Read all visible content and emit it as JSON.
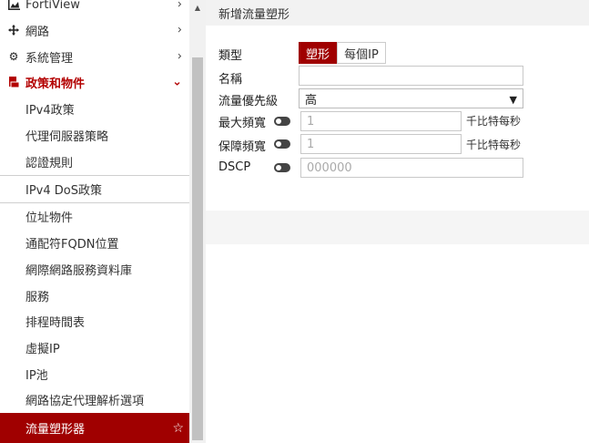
{
  "sidebar": {
    "top_items": [
      {
        "label": "FortiView",
        "icon": "chart-icon"
      },
      {
        "label": "網路",
        "icon": "move-icon"
      },
      {
        "label": "系統管理",
        "icon": "gear-icon"
      },
      {
        "label": "政策和物件",
        "icon": "policy-icon"
      }
    ],
    "sub_items": [
      {
        "label": "IPv4政策"
      },
      {
        "label": "代理伺服器策略"
      },
      {
        "label": "認證規則"
      },
      {
        "label": "IPv4 DoS政策"
      },
      {
        "label": "位址物件"
      },
      {
        "label": "通配符FQDN位置"
      },
      {
        "label": "網際網路服務資料庫"
      },
      {
        "label": "服務"
      },
      {
        "label": "排程時間表"
      },
      {
        "label": "虛擬IP"
      },
      {
        "label": "IP池"
      },
      {
        "label": "網路協定代理解析選項"
      },
      {
        "label": "流量塑形器"
      }
    ]
  },
  "form": {
    "title": "新增流量塑形",
    "type_label": "類型",
    "type_options": [
      "塑形",
      "每個IP"
    ],
    "name_label": "名稱",
    "name_value": "",
    "priority_label": "流量優先級",
    "priority_value": "高",
    "max_bw_label": "最大頻寬",
    "max_bw_placeholder": "1",
    "guaranteed_bw_label": "保障頻寬",
    "guaranteed_bw_placeholder": "1",
    "unit_label": "千比特每秒",
    "dscp_label": "DSCP",
    "dscp_placeholder": "000000"
  },
  "colors": {
    "accent": "#a00000"
  }
}
